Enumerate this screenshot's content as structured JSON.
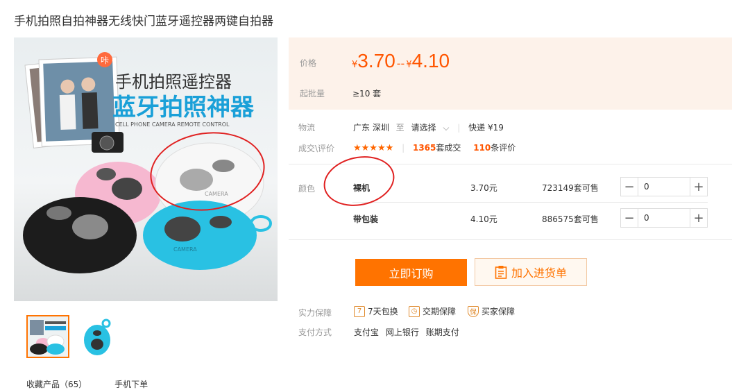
{
  "product": {
    "title": "手机拍照自拍神器无线快门蓝牙遥控器两键自拍器"
  },
  "gallery": {
    "banner_line1": "手机拍照遥控器",
    "banner_line2": "蓝牙拍照神器",
    "banner_sub": "CELL PHONE CAMERA REMOTE CONTROL",
    "badge": "咔",
    "remote_white_label": "CAMERA",
    "remote_blue_label": "CAMERA",
    "fav_label": "收藏产品（65）",
    "mobile_order_label": "手机下单"
  },
  "price": {
    "label": "价格",
    "currency": "¥",
    "low": "3.70",
    "range_sep": "--",
    "high": "4.10",
    "moq_label": "起批量",
    "moq_value": "≥10 套"
  },
  "logistics": {
    "label": "物流",
    "origin": "广东 深圳",
    "to": "至",
    "dest_select": "请选择",
    "method": "快递",
    "fee": "¥19"
  },
  "reviews": {
    "label": "成交\\评价",
    "stars": "★★★★★",
    "sold_count": "1365",
    "sold_unit": "套成交",
    "review_count": "110",
    "review_unit": "条评价"
  },
  "sku": {
    "label": "颜色",
    "rows": [
      {
        "name": "裸机",
        "price": "3.70元",
        "stock": "723149套可售",
        "qty": "0"
      },
      {
        "name": "带包装",
        "price": "4.10元",
        "stock": "886575套可售",
        "qty": "0"
      }
    ]
  },
  "actions": {
    "buy": "立即订购",
    "cart": "加入进货单"
  },
  "guarantee": {
    "label": "实力保障",
    "items": [
      "7天包换",
      "交期保障",
      "买家保障"
    ],
    "pay_label": "支付方式",
    "pay_methods": [
      "支付宝",
      "网上银行",
      "账期支付"
    ]
  },
  "colors": {
    "accent": "#ff7300",
    "price": "#ff5500",
    "annotation": "#e02020"
  }
}
